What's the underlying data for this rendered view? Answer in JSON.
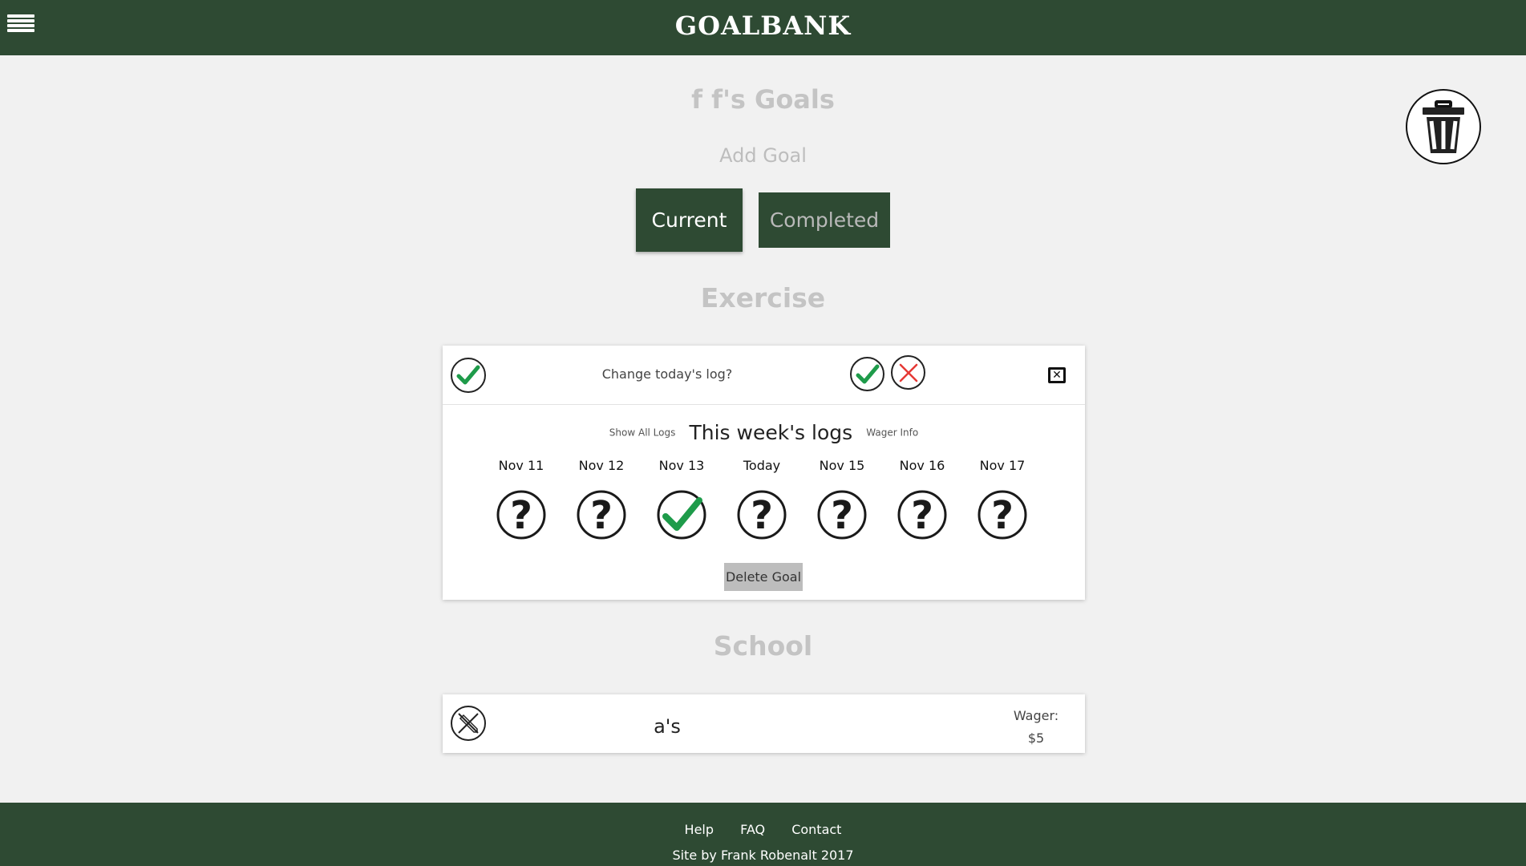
{
  "header": {
    "brand": "GOALBANK"
  },
  "page": {
    "title": "f f's Goals",
    "add_goal": "Add Goal",
    "tabs": {
      "current": "Current",
      "completed": "Completed"
    }
  },
  "exercise": {
    "category": "Exercise",
    "change_prompt": "Change today's log?",
    "show_all_logs": "Show All Logs",
    "logs_title": "This week's logs",
    "wager_info": "Wager Info",
    "days": [
      {
        "label": "Nov 11",
        "status": "unknown"
      },
      {
        "label": "Nov 12",
        "status": "unknown"
      },
      {
        "label": "Nov 13",
        "status": "done"
      },
      {
        "label": "Today",
        "status": "unknown"
      },
      {
        "label": "Nov 15",
        "status": "unknown"
      },
      {
        "label": "Nov 16",
        "status": "unknown"
      },
      {
        "label": "Nov 17",
        "status": "unknown"
      }
    ],
    "delete_goal": "Delete Goal"
  },
  "school": {
    "category": "School",
    "goal": "a's",
    "wager_label": "Wager:",
    "wager_amount": "$5"
  },
  "footer": {
    "links": [
      "Help",
      "FAQ",
      "Contact"
    ],
    "credit": "Site by Frank Robenalt 2017"
  },
  "colors": {
    "brand_green": "#2e4a33",
    "check_green": "#1e9b4a",
    "cross_red": "#e53935",
    "background": "#f1f1f1"
  }
}
